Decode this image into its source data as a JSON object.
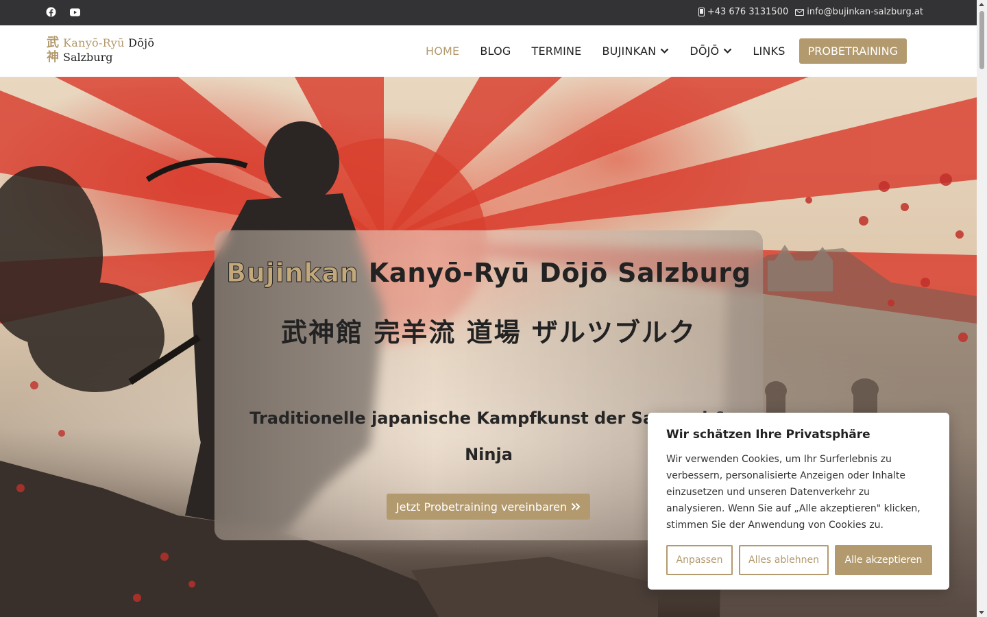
{
  "topbar": {
    "social": [
      {
        "icon": "facebook-icon"
      },
      {
        "icon": "youtube-icon"
      }
    ],
    "phone": "+43 676 3131500",
    "email": "info@bujinkan-salzburg.at"
  },
  "logo": {
    "kanji_top": "武",
    "kanji_bottom": "神",
    "line1_gold": "Kanyō-Ryū",
    "line1_dark": "Dōjō",
    "line2": "Salzburg"
  },
  "nav": {
    "items": [
      {
        "label": "HOME",
        "active": true
      },
      {
        "label": "BLOG"
      },
      {
        "label": "TERMINE"
      },
      {
        "label": "BUJINKAN",
        "dropdown": true
      },
      {
        "label": "DŌJŌ",
        "dropdown": true
      },
      {
        "label": "LINKS"
      }
    ],
    "cta": "PROBETRAINING"
  },
  "hero": {
    "title_highlight": "Bujinkan",
    "title_rest": "Kanyō-Ryū Dōjō Salzburg",
    "japanese": "武神館 完羊流 道場 ザルツブルク",
    "subtitle": "Traditionelle japanische Kampfkunst der Samurai & Ninja",
    "button": "Jetzt Probetraining vereinbaren"
  },
  "cookie": {
    "title": "Wir schätzen Ihre Privatsphäre",
    "text": "Wir verwenden Cookies, um Ihr Surferlebnis zu verbessern, personalisierte Anzeigen oder Inhalte einzusetzen und unseren Datenverkehr zu analysieren. Wenn Sie auf „Alle akzeptieren\" klicken, stimmen Sie der Anwendung von Cookies zu.",
    "customize": "Anpassen",
    "reject": "Alles ablehnen",
    "accept": "Alle akzeptieren"
  },
  "colors": {
    "accent": "#b39a6e",
    "topbar": "#333335"
  }
}
